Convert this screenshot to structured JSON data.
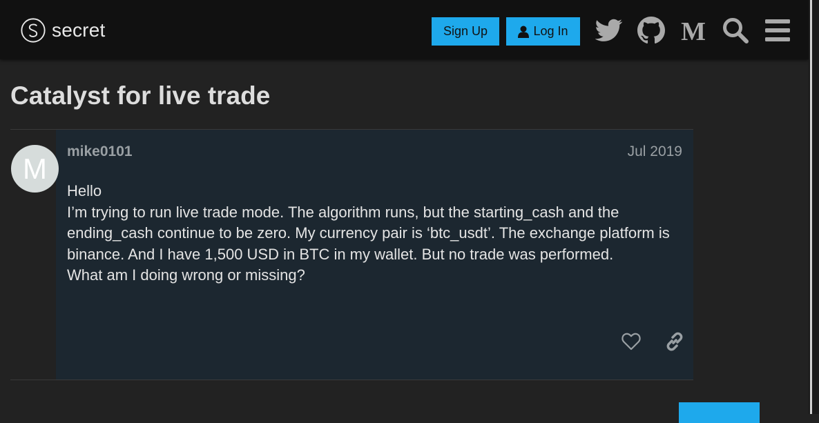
{
  "header": {
    "logo_text": "secret",
    "signup_label": "Sign Up",
    "login_label": "Log In",
    "icons": [
      "twitter-icon",
      "github-icon",
      "medium-icon",
      "search-icon",
      "hamburger-menu-icon"
    ]
  },
  "topic": {
    "title": "Catalyst for live trade"
  },
  "post": {
    "avatar_letter": "M",
    "username": "mike0101",
    "date": "Jul 2019",
    "lines": [
      "Hello",
      "I’m trying to run live trade mode. The algorithm runs, but the starting_cash and the ending_cash continue to be zero. My currency pair is ‘btc_usdt’. The exchange platform is binance. And I have 1,500 USD in BTC in my wallet. But no trade was performed.",
      "What am I doing wrong or missing?"
    ]
  },
  "colors": {
    "accent": "#1ea9ec",
    "header_bg": "#111111",
    "page_bg": "#222222",
    "post_bg": "#1c2730"
  }
}
